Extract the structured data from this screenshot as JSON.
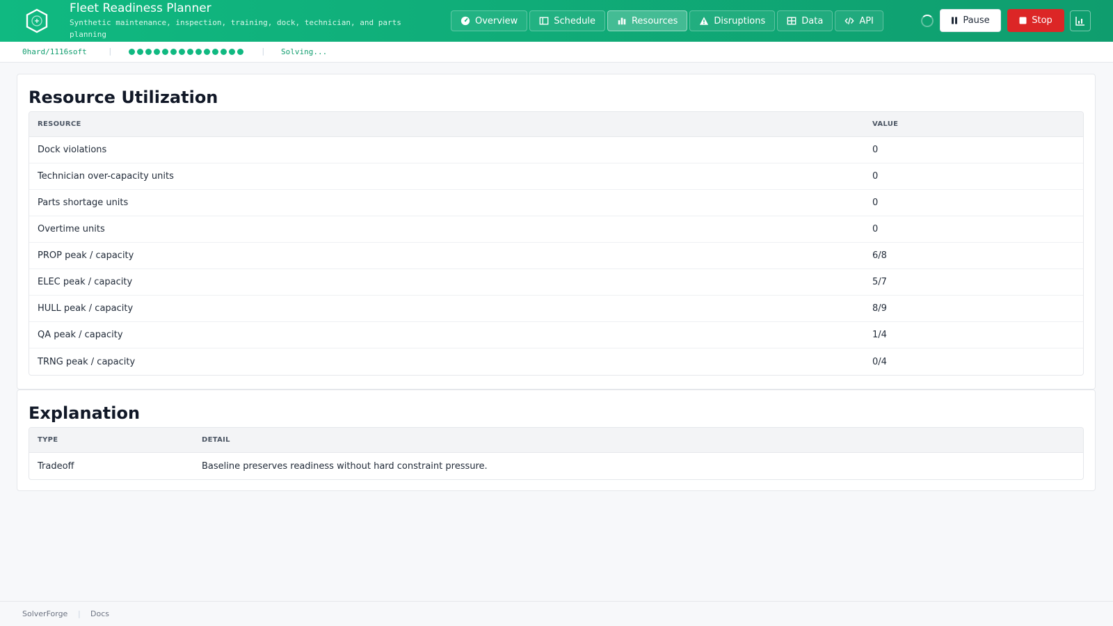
{
  "header": {
    "title": "Fleet Readiness Planner",
    "subtitle": "Synthetic maintenance, inspection, training, dock, technician, and parts planning",
    "tabs": [
      {
        "label": "Overview",
        "icon": "gauge-icon"
      },
      {
        "label": "Schedule",
        "icon": "calendar-icon"
      },
      {
        "label": "Resources",
        "icon": "bar-chart-icon",
        "active": true
      },
      {
        "label": "Disruptions",
        "icon": "warning-icon"
      },
      {
        "label": "Data",
        "icon": "table-icon"
      },
      {
        "label": "API",
        "icon": "code-icon"
      }
    ],
    "pause_label": "Pause",
    "stop_label": "Stop",
    "colors": {
      "accent": "#10b981",
      "stop": "#dc2626"
    }
  },
  "status": {
    "score": "0hard/1116soft",
    "progress_dots": 14,
    "solving": "Solving..."
  },
  "resources": {
    "title": "Resource Utilization",
    "headers": [
      "RESOURCE",
      "VALUE"
    ],
    "rows": [
      {
        "resource": "Dock violations",
        "value": "0"
      },
      {
        "resource": "Technician over-capacity units",
        "value": "0"
      },
      {
        "resource": "Parts shortage units",
        "value": "0"
      },
      {
        "resource": "Overtime units",
        "value": "0"
      },
      {
        "resource": "PROP peak / capacity",
        "value": "6/8"
      },
      {
        "resource": "ELEC peak / capacity",
        "value": "5/7"
      },
      {
        "resource": "HULL peak / capacity",
        "value": "8/9"
      },
      {
        "resource": "QA peak / capacity",
        "value": "1/4"
      },
      {
        "resource": "TRNG peak / capacity",
        "value": "0/4"
      }
    ]
  },
  "explanation": {
    "title": "Explanation",
    "headers": [
      "TYPE",
      "DETAIL"
    ],
    "rows": [
      {
        "type": "Tradeoff",
        "detail": "Baseline preserves readiness without hard constraint pressure."
      }
    ]
  },
  "footer": {
    "links": [
      "SolverForge",
      "Docs"
    ]
  }
}
